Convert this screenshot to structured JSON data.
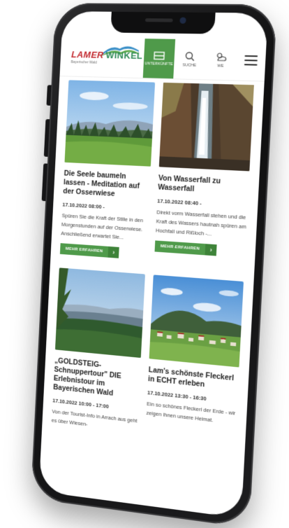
{
  "brand": {
    "word1": "LAMER",
    "word2": "WINKEL",
    "tagline": "Bayerischer Wald"
  },
  "nav": [
    {
      "label": "Unterkünfte",
      "icon": "bed-icon",
      "active": true
    },
    {
      "label": "Suche",
      "icon": "search-icon",
      "active": false
    },
    {
      "label": "WE",
      "icon": "weather-icon",
      "active": false
    }
  ],
  "colors": {
    "accent": "#4f9a4a",
    "brand_red": "#c2272d"
  },
  "cards": [
    {
      "title": "Die Seele baumeln lassen - Meditation auf der Osserwiese",
      "date": "17.10.2022 08:00 -",
      "desc": "Spüren Sie die Kraft der Stille in den Morgenstunden auf der Osserwiese. Anschließend erwartet Sie...",
      "button": "Mehr erfahren",
      "image": "meadow-forest-photo"
    },
    {
      "title": "Von Wasserfall zu Wasserfall",
      "date": "17.10.2022 08:40 -",
      "desc": "Direkt vorm Wasserfall stehen und die Kraft des Wassers hautnah spüren am Hochfall und Rißloch -...",
      "button": "Mehr erfahren",
      "image": "waterfall-photo"
    },
    {
      "title": "„GOLDSTEIG-Schnuppertour\" DIE Erlebnistour im Bayerischen Wald",
      "date": "17.10.2022 10:00 - 17:00",
      "desc": "Von der Tourist-Info in Arrach aus geht es über Wiesen-",
      "button": "",
      "image": "valley-view-photo"
    },
    {
      "title": "Lam's schönste Fleckerl in ECHT erleben",
      "date": "17.10.2022 13:30 - 16:30",
      "desc": "Ein so schönes Fleckerl der Erde - wir zeigen Ihnen unsere Heimat.",
      "button": "",
      "image": "village-photo"
    }
  ]
}
